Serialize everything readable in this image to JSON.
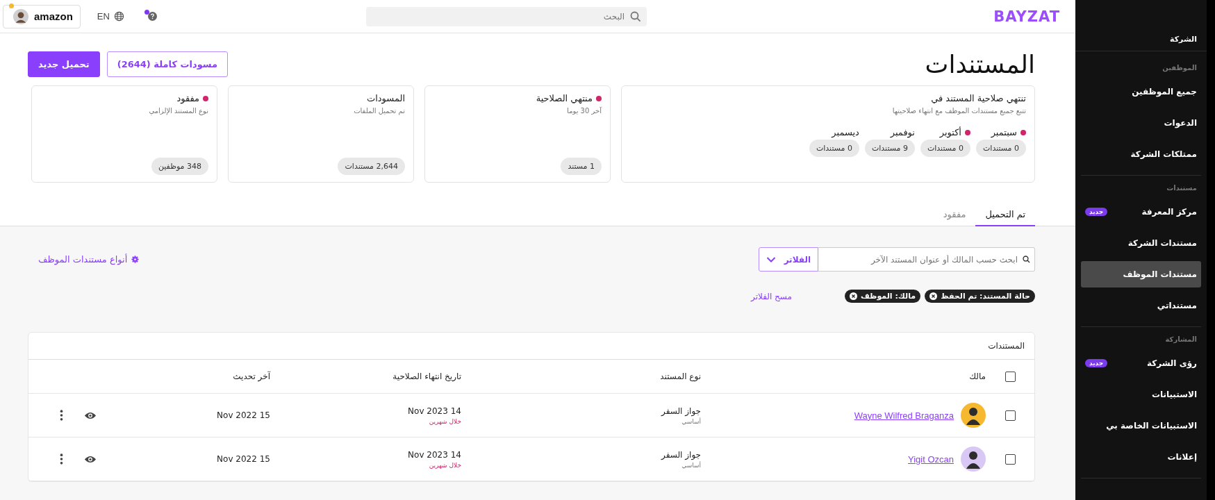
{
  "topbar": {
    "company": "amazon",
    "company_notification": true,
    "language": "EN",
    "help_notification": true,
    "search": {
      "placeholder": "البحث"
    },
    "logo": "BAYZAT"
  },
  "page": {
    "title": "المستندات",
    "buttons": [
      {
        "label": "مسودات كاملة (2644)",
        "kind": "outline"
      },
      {
        "label": "تحميل جديد",
        "kind": "primary"
      }
    ]
  },
  "expiry_card": {
    "title": "تنتهي صلاحية المستند في",
    "subtitle": "تتبع جميع مستندات الموظف مع انتهاء صلاحيتها",
    "months": [
      {
        "name": "سبتمبر",
        "dot": true,
        "count": "0 مستندات"
      },
      {
        "name": "أكتوبر",
        "dot": true,
        "count": "0 مستندات"
      },
      {
        "name": "نوفمبر",
        "dot": false,
        "count": "9 مستندات"
      },
      {
        "name": "ديسمبر",
        "dot": false,
        "count": "0 مستندات"
      }
    ]
  },
  "cards": [
    {
      "title": "منتهي الصلاحية",
      "subtitle": "آخر 30 يوما",
      "dot": true,
      "count": "1 مستند"
    },
    {
      "title": "المسودات",
      "subtitle": "تم تحميل الملفات",
      "dot": false,
      "count": "2,644 مستندات"
    },
    {
      "title": "مفقود",
      "subtitle": "نوع المستند الإلزامي",
      "dot": true,
      "count": "348 موظفين"
    }
  ],
  "tabs": [
    {
      "label": "تم التحميل",
      "selected": true
    },
    {
      "label": "مفقود",
      "selected": false
    }
  ],
  "toolbar": {
    "search": {
      "placeholder": "ابحث حسب المالك أو عنوان المستند الآخر"
    },
    "filter_button": "الفلاتر",
    "types_link": "أنواع مستندات الموظف"
  },
  "filters": {
    "chips": [
      "حالة المستند: تم الحفظ",
      "مالك: الموظف"
    ],
    "clear": "مسح الفلاتر"
  },
  "table": {
    "title": "المستندات",
    "all_checked": false,
    "columns": [
      "مالك",
      "نوع المستند",
      "تاريخ انتهاء الصلاحية",
      "آخر تحديث"
    ],
    "rows": [
      {
        "checked": false,
        "owner": "Wayne Wilfred Braganza",
        "doc_type": "جواز السفر",
        "doc_category": "أساسي",
        "expiry": "14 Nov 2023",
        "expiry_note": "خلال شهرين",
        "updated": "15 Nov 2022"
      },
      {
        "checked": false,
        "owner": "Yigit Ozcan",
        "doc_type": "جواز السفر",
        "doc_category": "أساسي",
        "expiry": "14 Nov 2023",
        "expiry_note": "خلال شهرين",
        "updated": "15 Nov 2022"
      }
    ]
  },
  "sidebar": {
    "header": "الشركة",
    "sections": [
      {
        "title": "الموظفين",
        "items": [
          {
            "label": "جميع الموظفين",
            "selected": false
          },
          {
            "label": "الدعوات",
            "selected": false
          },
          {
            "label": "ممتلكات الشركة",
            "selected": false
          }
        ]
      },
      {
        "title": "مستندات",
        "items": [
          {
            "label": "مركز المعرفة",
            "selected": false,
            "badge": "جديد"
          },
          {
            "label": "مستندات الشركة",
            "selected": false
          },
          {
            "label": "مستندات الموظف",
            "selected": true
          },
          {
            "label": "مستنداتي",
            "selected": false
          }
        ]
      },
      {
        "title": "المشاركة",
        "items": [
          {
            "label": "رؤى الشركة",
            "selected": false,
            "badge": "جديد"
          },
          {
            "label": "الاستبيانات",
            "selected": false
          },
          {
            "label": "الاستبيانات الخاصة بي",
            "selected": false
          },
          {
            "label": "إعلانات",
            "selected": false
          }
        ]
      }
    ]
  }
}
